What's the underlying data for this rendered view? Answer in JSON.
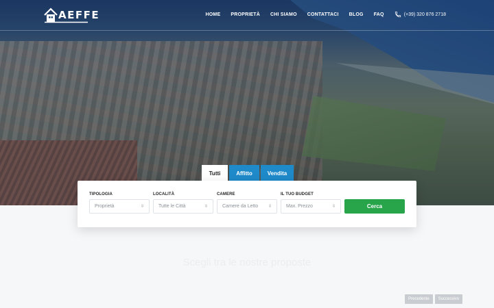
{
  "brand": {
    "name": "AEFFE"
  },
  "nav": {
    "items": [
      "HOME",
      "PROPRIETÀ",
      "CHI SIAMO",
      "CONTATTACI",
      "BLOG",
      "FAQ"
    ],
    "phone": "(+39) 320 876 2718"
  },
  "tabs": [
    {
      "label": "Tutti",
      "active": true
    },
    {
      "label": "Affitto",
      "active": false
    },
    {
      "label": "Vendita",
      "active": false
    }
  ],
  "search": {
    "fields": [
      {
        "label": "TIPOLOGIA",
        "value": "Proprietà"
      },
      {
        "label": "LOCALITÀ",
        "value": "Tutte le Città"
      },
      {
        "label": "CAMERE",
        "value": "Camere da Letto"
      },
      {
        "label": "IL TUO BUDGET",
        "value": "Max. Prezzo"
      }
    ],
    "button": "Cerca"
  },
  "section": {
    "title": "Scegli tra le nostre proposte"
  },
  "pager": {
    "prev": "Precedente",
    "next": "Successivo"
  },
  "colors": {
    "accent_blue": "#1f8ac9",
    "search_green": "#28a44a",
    "white": "#ffffff"
  }
}
